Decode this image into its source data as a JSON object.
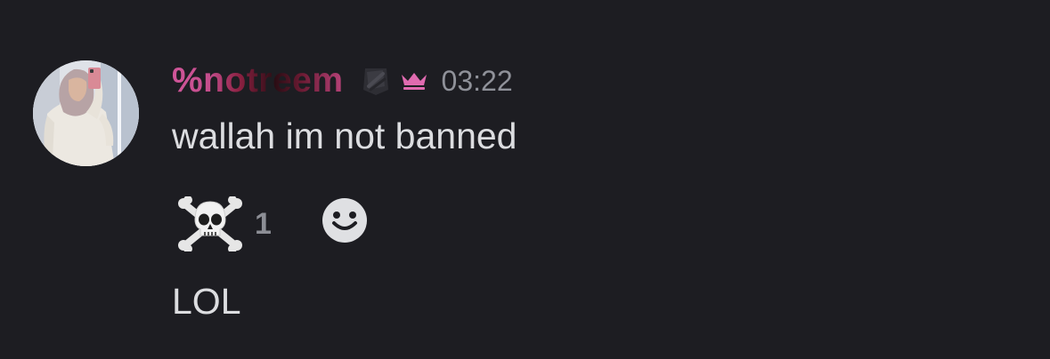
{
  "message": {
    "author": "%notreem",
    "timestamp": "03:22",
    "content": "wallah im not banned",
    "reactions": [
      {
        "icon": "skull-crossbones-icon",
        "count": "1"
      }
    ]
  },
  "next_message": {
    "content": "LOL"
  },
  "colors": {
    "background": "#1d1d22",
    "username_accent": "#d0569a",
    "crown": "#e06bb0",
    "timestamp": "#8f9199",
    "text": "#dcdde0"
  }
}
